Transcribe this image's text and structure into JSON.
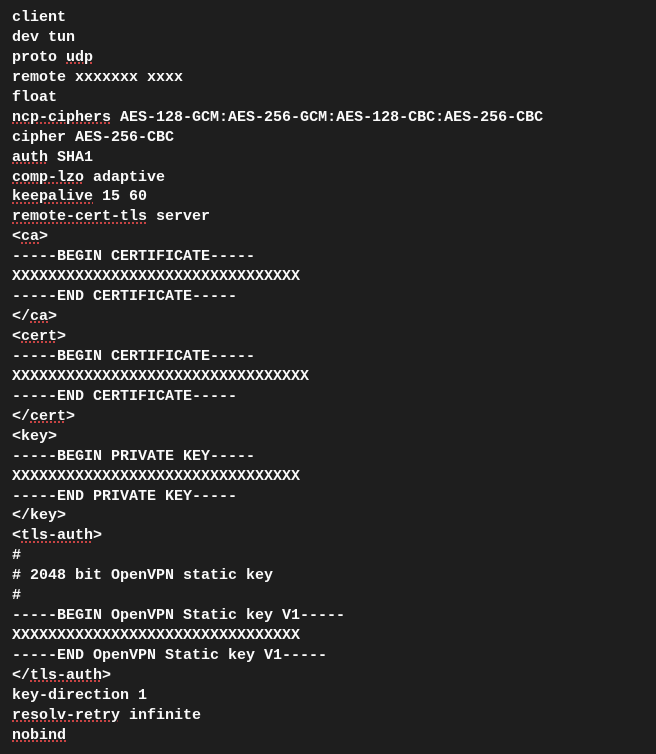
{
  "config_lines": [
    {
      "segments": [
        {
          "text": "client"
        }
      ]
    },
    {
      "segments": [
        {
          "text": "dev tun"
        }
      ]
    },
    {
      "segments": [
        {
          "text": "proto "
        },
        {
          "text": "udp",
          "underline": true
        }
      ]
    },
    {
      "segments": [
        {
          "text": "remote xxxxxxx xxxx"
        }
      ]
    },
    {
      "segments": [
        {
          "text": "float"
        }
      ]
    },
    {
      "segments": [
        {
          "text": "ncp-ciphers",
          "underline": true
        },
        {
          "text": " AES-128-GCM:AES-256-GCM:AES-128-CBC:AES-256-CBC"
        }
      ]
    },
    {
      "segments": [
        {
          "text": "cipher AES-256-CBC"
        }
      ]
    },
    {
      "segments": [
        {
          "text": "auth",
          "underline": true
        },
        {
          "text": " SHA1"
        }
      ]
    },
    {
      "segments": [
        {
          "text": "comp-lzo",
          "underline": true
        },
        {
          "text": " adaptive"
        }
      ]
    },
    {
      "segments": [
        {
          "text": "keepalive",
          "underline": true
        },
        {
          "text": " 15 60"
        }
      ]
    },
    {
      "segments": [
        {
          "text": "remote-cert-tls",
          "underline": true
        },
        {
          "text": " server"
        }
      ]
    },
    {
      "segments": [
        {
          "text": "<"
        },
        {
          "text": "ca",
          "underline": true
        },
        {
          "text": ">"
        }
      ]
    },
    {
      "segments": [
        {
          "text": "-----BEGIN CERTIFICATE-----"
        }
      ]
    },
    {
      "segments": [
        {
          "text": "XXXXXXXXXXXXXXXXXXXXXXXXXXXXXXXX"
        }
      ]
    },
    {
      "segments": [
        {
          "text": "-----END CERTIFICATE-----"
        }
      ]
    },
    {
      "segments": [
        {
          "text": "</"
        },
        {
          "text": "ca",
          "underline": true
        },
        {
          "text": ">"
        }
      ]
    },
    {
      "segments": [
        {
          "text": "<"
        },
        {
          "text": "cert",
          "underline": true
        },
        {
          "text": ">"
        }
      ]
    },
    {
      "segments": [
        {
          "text": "-----BEGIN CERTIFICATE-----"
        }
      ]
    },
    {
      "segments": [
        {
          "text": "XXXXXXXXXXXXXXXXXXXXXXXXXXXXXXXXX"
        }
      ]
    },
    {
      "segments": [
        {
          "text": "-----END CERTIFICATE-----"
        }
      ]
    },
    {
      "segments": [
        {
          "text": "</"
        },
        {
          "text": "cert",
          "underline": true
        },
        {
          "text": ">"
        }
      ]
    },
    {
      "segments": [
        {
          "text": "<key>"
        }
      ]
    },
    {
      "segments": [
        {
          "text": "-----BEGIN PRIVATE KEY-----"
        }
      ]
    },
    {
      "segments": [
        {
          "text": "XXXXXXXXXXXXXXXXXXXXXXXXXXXXXXXX"
        }
      ]
    },
    {
      "segments": [
        {
          "text": "-----END PRIVATE KEY-----"
        }
      ]
    },
    {
      "segments": [
        {
          "text": "</key>"
        }
      ]
    },
    {
      "segments": [
        {
          "text": "<"
        },
        {
          "text": "tls-auth",
          "underline": true
        },
        {
          "text": ">"
        }
      ]
    },
    {
      "segments": [
        {
          "text": "#"
        }
      ]
    },
    {
      "segments": [
        {
          "text": "# 2048 bit OpenVPN static key"
        }
      ]
    },
    {
      "segments": [
        {
          "text": "#"
        }
      ]
    },
    {
      "segments": [
        {
          "text": "-----BEGIN OpenVPN Static key V1-----"
        }
      ]
    },
    {
      "segments": [
        {
          "text": "XXXXXXXXXXXXXXXXXXXXXXXXXXXXXXXX"
        }
      ]
    },
    {
      "segments": [
        {
          "text": "-----END OpenVPN Static key V1-----"
        }
      ]
    },
    {
      "segments": [
        {
          "text": "</"
        },
        {
          "text": "tls-auth",
          "underline": true
        },
        {
          "text": ">"
        }
      ]
    },
    {
      "segments": [
        {
          "text": "key-direction 1"
        }
      ]
    },
    {
      "segments": [
        {
          "text": "resolv-retry",
          "underline": true
        },
        {
          "text": " infinite"
        }
      ]
    },
    {
      "segments": [
        {
          "text": "nobind",
          "underline": true
        }
      ]
    }
  ]
}
